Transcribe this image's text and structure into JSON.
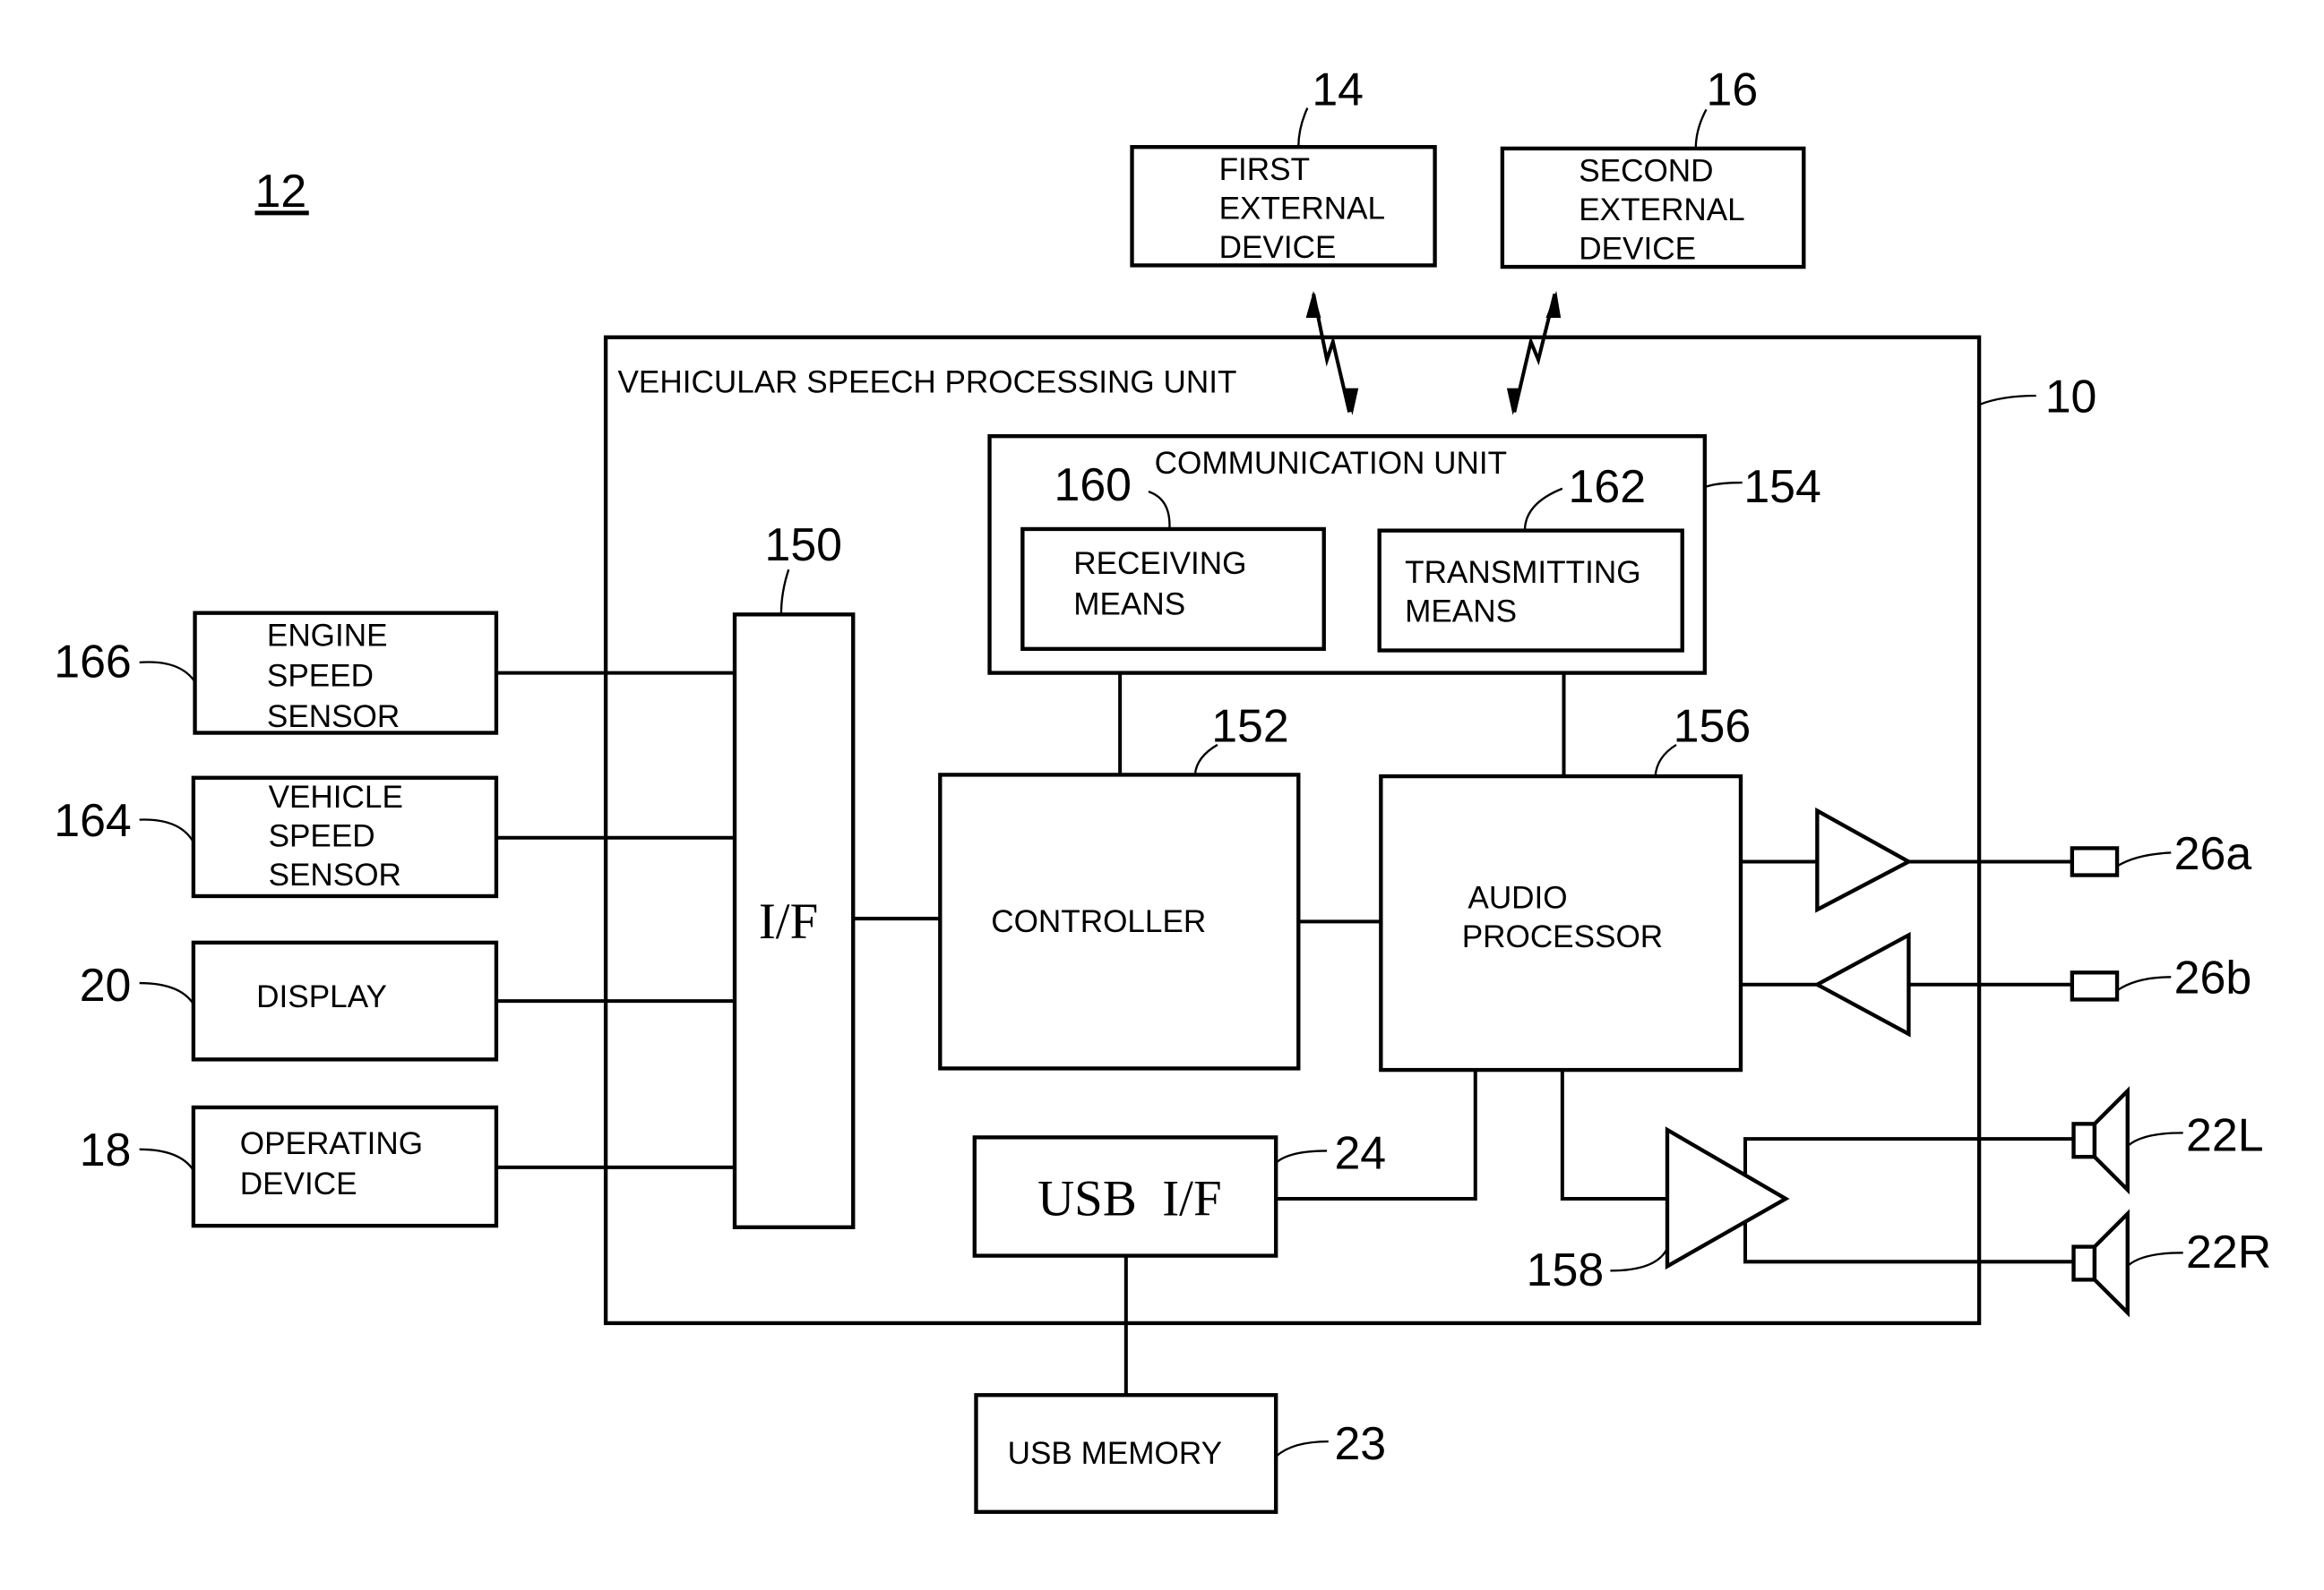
{
  "figure": {
    "figure_ref": "12",
    "main_unit": {
      "title": "VEHICULAR SPEECH PROCESSING UNIT",
      "ref": "10"
    },
    "external_devices": [
      {
        "lines": [
          "FIRST",
          "EXTERNAL",
          "DEVICE"
        ],
        "ref": "14"
      },
      {
        "lines": [
          "SECOND",
          "EXTERNAL",
          "DEVICE"
        ],
        "ref": "16"
      }
    ],
    "communication_unit": {
      "title": "COMMUNICATION UNIT",
      "ref": "154",
      "receiving": {
        "lines": [
          "RECEIVING",
          "MEANS"
        ],
        "ref": "160"
      },
      "transmitting": {
        "lines": [
          "TRANSMITTING",
          "MEANS"
        ],
        "ref": "162"
      }
    },
    "interface": {
      "label": "I/F",
      "ref": "150"
    },
    "controller": {
      "label": "CONTROLLER",
      "ref": "152"
    },
    "audio_processor": {
      "lines": [
        "AUDIO",
        "PROCESSOR"
      ],
      "ref": "156"
    },
    "usb_if": {
      "label": "USB  I/F",
      "ref": "24"
    },
    "usb_memory": {
      "label": "USB MEMORY",
      "ref": "23"
    },
    "amplifier": {
      "ref": "158"
    },
    "sensors": [
      {
        "lines": [
          "ENGINE",
          "SPEED",
          "SENSOR"
        ],
        "ref": "166"
      },
      {
        "lines": [
          "VEHICLE",
          "SPEED",
          "SENSOR"
        ],
        "ref": "164"
      },
      {
        "lines": [
          "DISPLAY"
        ],
        "ref": "20"
      },
      {
        "lines": [
          "OPERATING",
          "DEVICE"
        ],
        "ref": "18"
      }
    ],
    "terminals": [
      {
        "ref": "26a"
      },
      {
        "ref": "26b"
      }
    ],
    "speakers": [
      {
        "ref": "22L"
      },
      {
        "ref": "22R"
      }
    ]
  }
}
